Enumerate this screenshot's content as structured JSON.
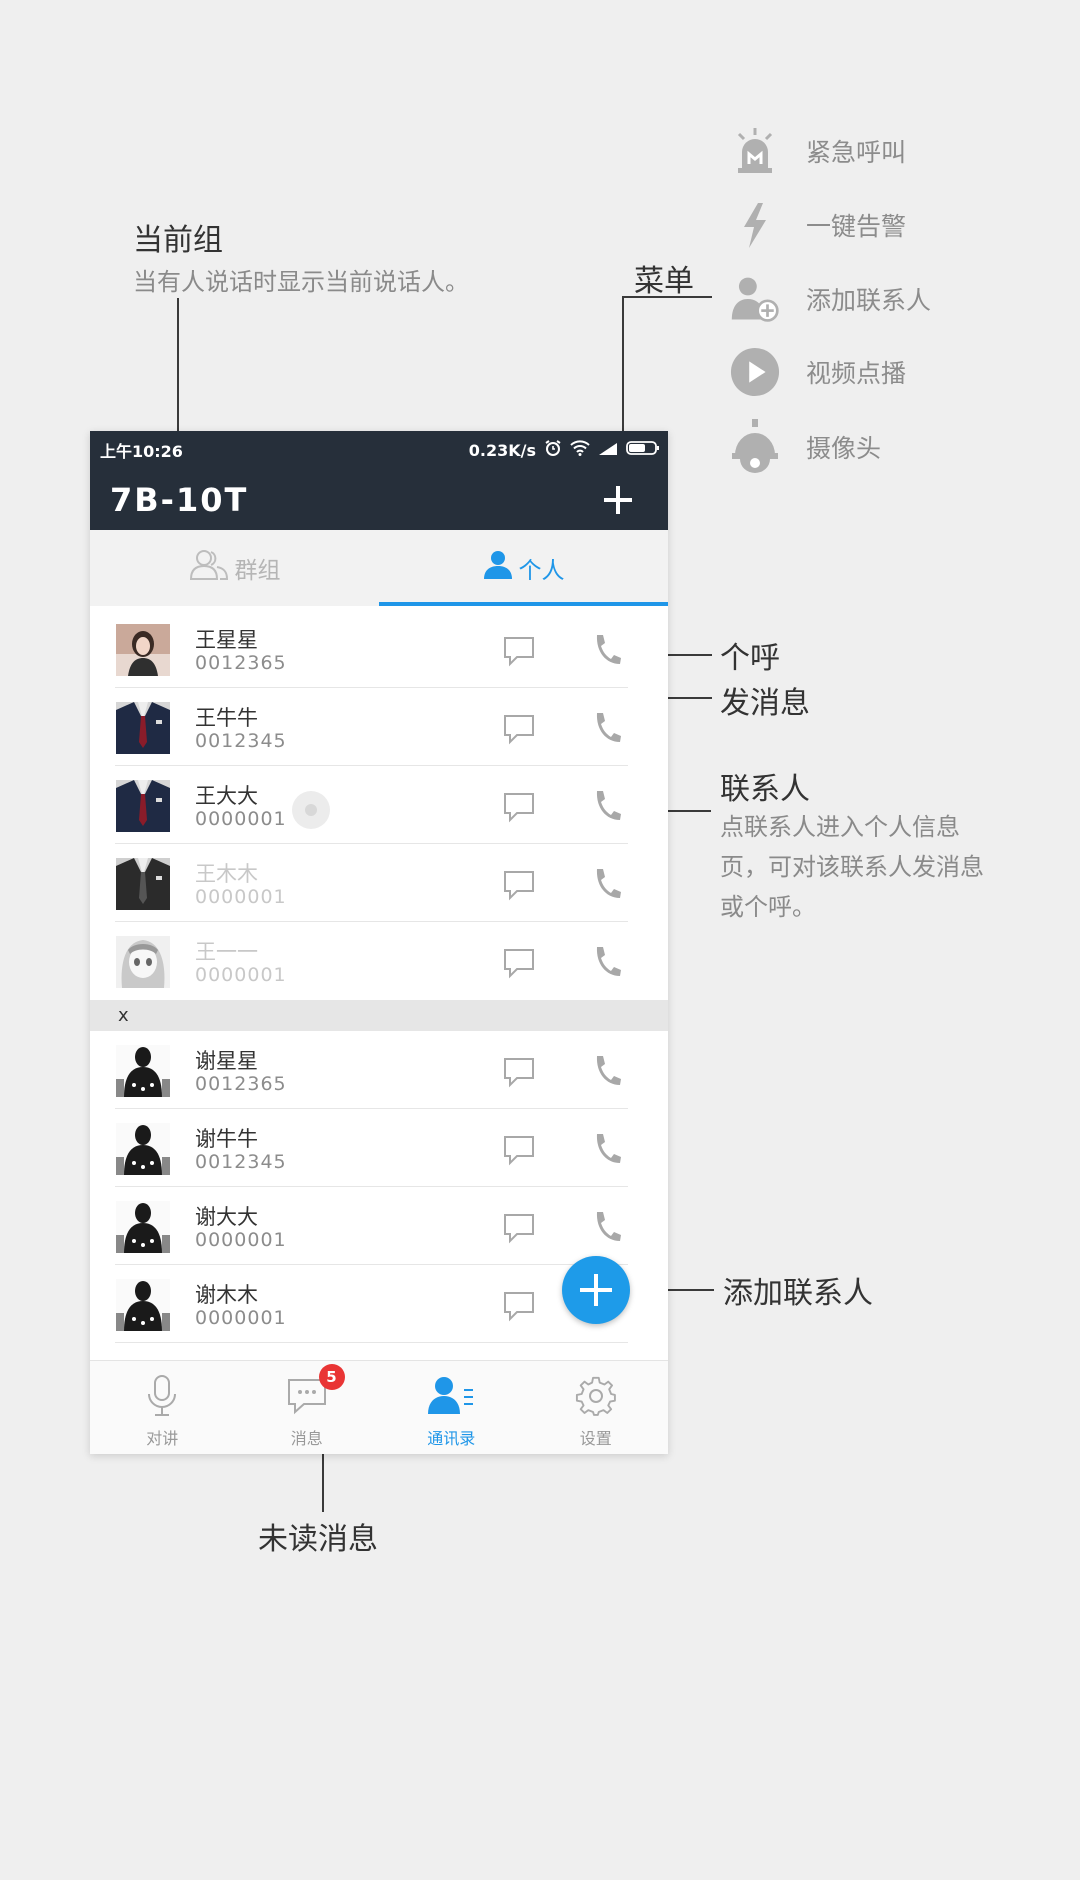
{
  "annotations": {
    "current_group": {
      "title": "当前组",
      "desc": "当有人说话时显示当前说话人。"
    },
    "menu": {
      "title": "菜单"
    },
    "call": {
      "title": "个呼"
    },
    "send_msg": {
      "title": "发消息"
    },
    "contact": {
      "title": "联系人",
      "desc": "点联系人进入个人信息页，可对该联系人发消息或个呼。"
    },
    "add_contact": {
      "title": "添加联系人"
    },
    "unread": {
      "title": "未读消息"
    }
  },
  "menu_items": [
    {
      "icon": "alarm-light-icon",
      "label": "紧急呼叫"
    },
    {
      "icon": "lightning-icon",
      "label": "一键告警"
    },
    {
      "icon": "add-person-icon",
      "label": "添加联系人"
    },
    {
      "icon": "play-circle-icon",
      "label": "视频点播"
    },
    {
      "icon": "camera-dome-icon",
      "label": "摄像头"
    }
  ],
  "status_bar": {
    "time": "上午10:26",
    "speed": "0.23K/s"
  },
  "app_bar": {
    "title": "7B-10T"
  },
  "tabs": [
    {
      "label": "群组",
      "active": false
    },
    {
      "label": "个人",
      "active": true
    }
  ],
  "contacts_w": [
    {
      "name": "王星星",
      "number": "0012365",
      "faded": false
    },
    {
      "name": "王牛牛",
      "number": "0012345",
      "faded": false
    },
    {
      "name": "王大大",
      "number": "0000001",
      "faded": false
    },
    {
      "name": "王木木",
      "number": "0000001",
      "faded": true
    },
    {
      "name": "王一一",
      "number": "0000001",
      "faded": true
    }
  ],
  "section_x": "x",
  "contacts_x": [
    {
      "name": "谢星星",
      "number": "0012365"
    },
    {
      "name": "谢牛牛",
      "number": "0012345"
    },
    {
      "name": "谢大大",
      "number": "0000001"
    },
    {
      "name": "谢木木",
      "number": "0000001"
    }
  ],
  "bottom_nav": [
    {
      "label": "对讲",
      "active": false
    },
    {
      "label": "消息",
      "active": false,
      "badge": "5"
    },
    {
      "label": "通讯录",
      "active": true
    },
    {
      "label": "设置",
      "active": false
    }
  ],
  "colors": {
    "accent": "#1f96e8",
    "header_bg": "#262f3a",
    "badge": "#e93535",
    "page_bg": "#efefef"
  }
}
